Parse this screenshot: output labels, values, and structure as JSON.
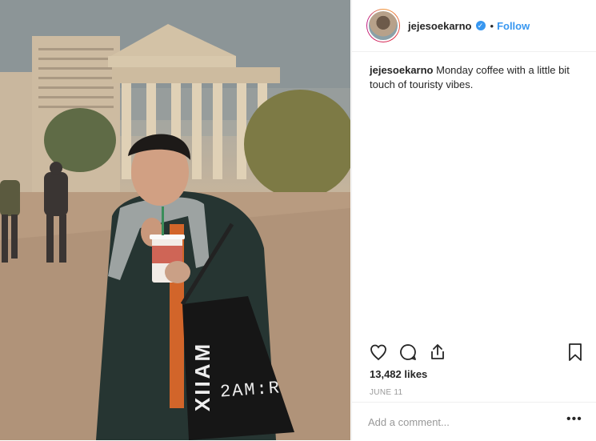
{
  "post": {
    "username": "jejesoekarno",
    "verified_icon": "verified-badge-icon",
    "follow_label": "Follow",
    "dot": "•",
    "caption_user": "jejesoekarno",
    "caption_text": "Monday coffee with a little bit touch of touristy vibes.",
    "likes": "13,482 likes",
    "date": "JUNE 11",
    "comment_placeholder": "Add a comment...",
    "more_label": "•••",
    "cup_text": "2AM:R",
    "bag_text": "XIIAM"
  },
  "icons": {
    "like": "heart-icon",
    "comment": "comment-icon",
    "share": "share-icon",
    "save": "bookmark-icon",
    "verified": "checkmark-icon"
  },
  "colors": {
    "accent": "#3897f0",
    "text": "#262626",
    "muted": "#999999",
    "border": "#efefef"
  }
}
